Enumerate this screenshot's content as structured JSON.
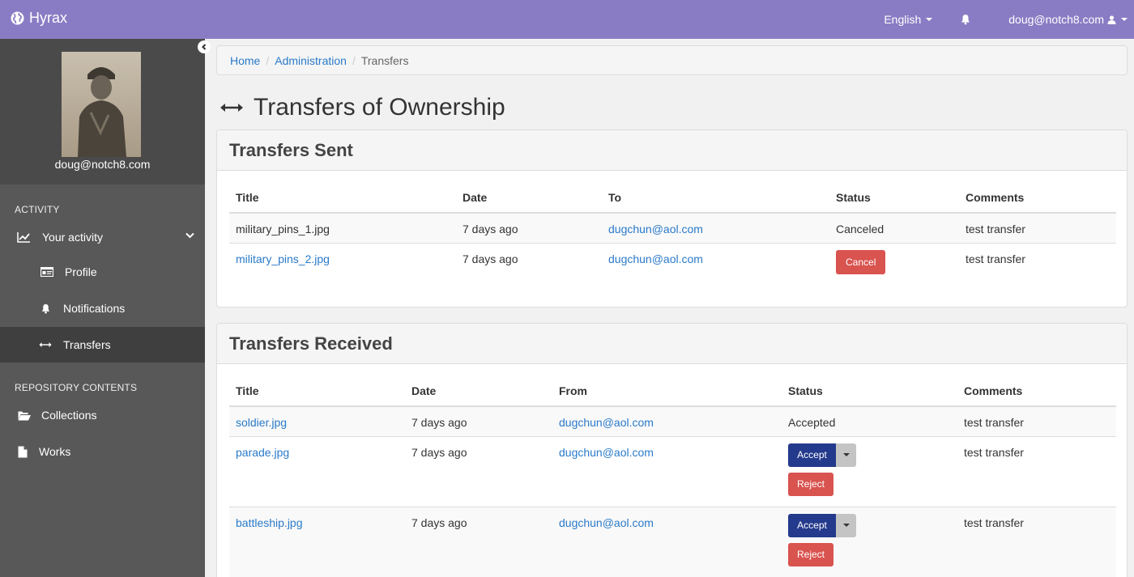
{
  "navbar": {
    "brand": "Hyrax",
    "language": "English",
    "user": "doug@notch8.com"
  },
  "sidebar": {
    "profile_email": "doug@notch8.com",
    "activity_label": "ACTIVITY",
    "your_activity": "Your activity",
    "profile": "Profile",
    "notifications": "Notifications",
    "transfers": "Transfers",
    "repo_label": "REPOSITORY CONTENTS",
    "collections": "Collections",
    "works": "Works"
  },
  "breadcrumb": {
    "home": "Home",
    "administration": "Administration",
    "current": "Transfers"
  },
  "page_title": "Transfers of Ownership",
  "sent": {
    "heading": "Transfers Sent",
    "columns": [
      "Title",
      "Date",
      "To",
      "Status",
      "Comments"
    ],
    "rows": [
      {
        "title": "military_pins_1.jpg",
        "date": "7 days ago",
        "to": "dugchun@aol.com",
        "status": "Canceled",
        "comments": "test transfer"
      },
      {
        "title": "military_pins_2.jpg",
        "date": "7 days ago",
        "to": "dugchun@aol.com",
        "status": "Cancel",
        "comments": "test transfer"
      }
    ]
  },
  "received": {
    "heading": "Transfers Received",
    "columns": [
      "Title",
      "Date",
      "From",
      "Status",
      "Comments"
    ],
    "rows": [
      {
        "title": "soldier.jpg",
        "date": "7 days ago",
        "from": "dugchun@aol.com",
        "status": "Accepted",
        "comments": "test transfer"
      },
      {
        "title": "parade.jpg",
        "date": "7 days ago",
        "from": "dugchun@aol.com",
        "accept": "Accept",
        "reject": "Reject",
        "comments": "test transfer"
      },
      {
        "title": "battleship.jpg",
        "date": "7 days ago",
        "from": "dugchun@aol.com",
        "accept": "Accept",
        "reject": "Reject",
        "comments": "test transfer"
      }
    ]
  },
  "colors": {
    "navbar": "#8a7cc4",
    "sidebar": "#585858",
    "link": "#2a7ac9",
    "danger": "#d9534f",
    "primary": "#243a8c"
  }
}
